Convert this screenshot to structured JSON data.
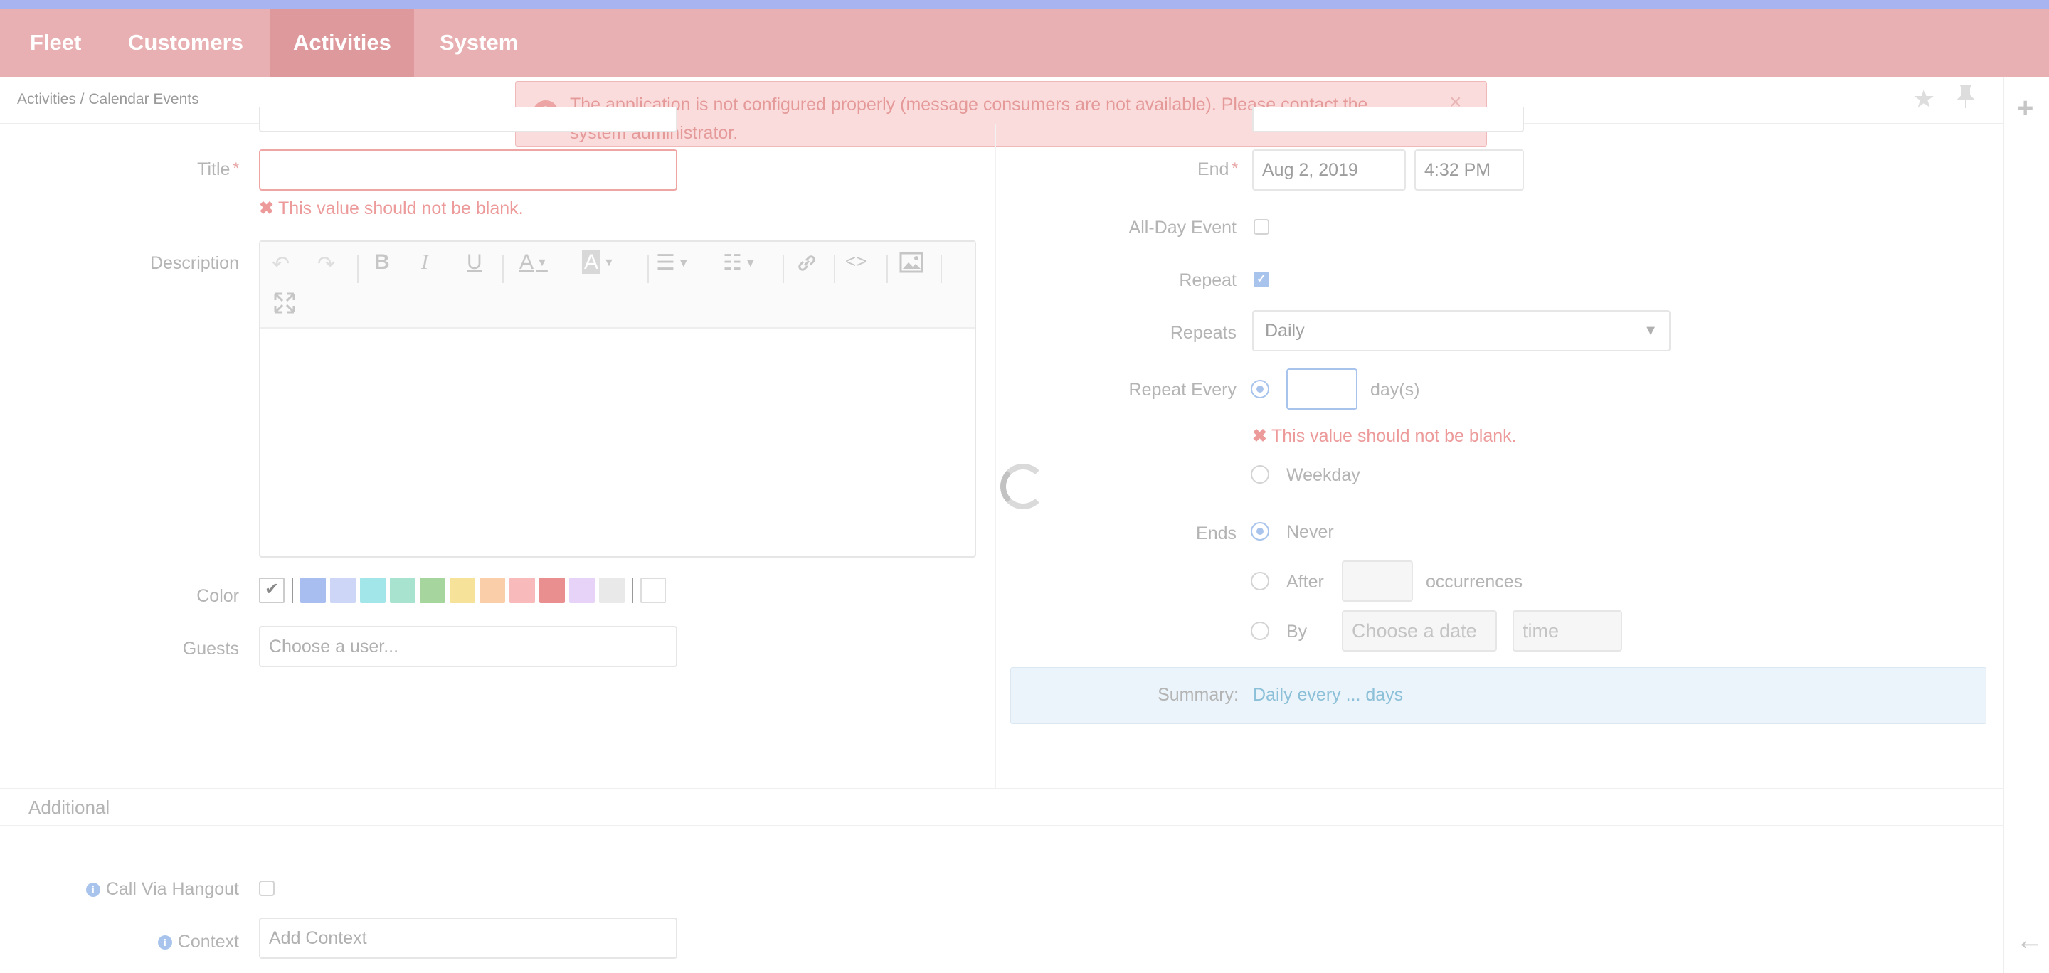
{
  "nav": {
    "items": [
      {
        "label": "Fleet"
      },
      {
        "label": "Customers"
      },
      {
        "label": "Activities"
      },
      {
        "label": "System"
      }
    ]
  },
  "breadcrumb": "Activities / Calendar Events",
  "alert": {
    "message": "The application is not configured properly (message consumers are not available). Please contact the system administrator.",
    "icon": "!",
    "close": "×"
  },
  "form": {
    "title_label": "Title",
    "title_value": "",
    "required_mark": "*",
    "error_blank": "This value should not be blank.",
    "error_icon": "✖",
    "description_label": "Description",
    "color_label": "Color",
    "guests_label": "Guests",
    "guests_placeholder": "Choose a user...",
    "end_label": "End",
    "end_date": "Aug 2, 2019",
    "end_time": "4:32 PM",
    "allday_label": "All-Day Event",
    "repeat_label": "Repeat",
    "repeats_label": "Repeats",
    "repeats_value": "Daily",
    "repeat_every_label": "Repeat Every",
    "repeat_every_value": "",
    "days_unit": "day(s)",
    "weekday_label": "Weekday",
    "ends_label": "Ends",
    "never_label": "Never",
    "after_label": "After",
    "occurrences_label": "occurrences",
    "by_label": "By",
    "by_date_placeholder": "Choose a date",
    "by_time_placeholder": "time",
    "summary_label": "Summary:",
    "summary_value": "Daily every ... days"
  },
  "additional": {
    "section_title": "Additional",
    "hangout_label": "Call Via Hangout",
    "context_label": "Context",
    "context_placeholder": "Add Context"
  },
  "colors": [
    "#a8bdf0",
    "#cdd6f6",
    "#a3e6ea",
    "#a8e3d0",
    "#a6d69e",
    "#f7e29a",
    "#f9cea8",
    "#f8baba",
    "#ea8f8f",
    "#e6d3f7",
    "#e9e9e9"
  ],
  "icons": {
    "star": "★",
    "pin": "📌",
    "plus": "+",
    "back_arrow": "←"
  }
}
